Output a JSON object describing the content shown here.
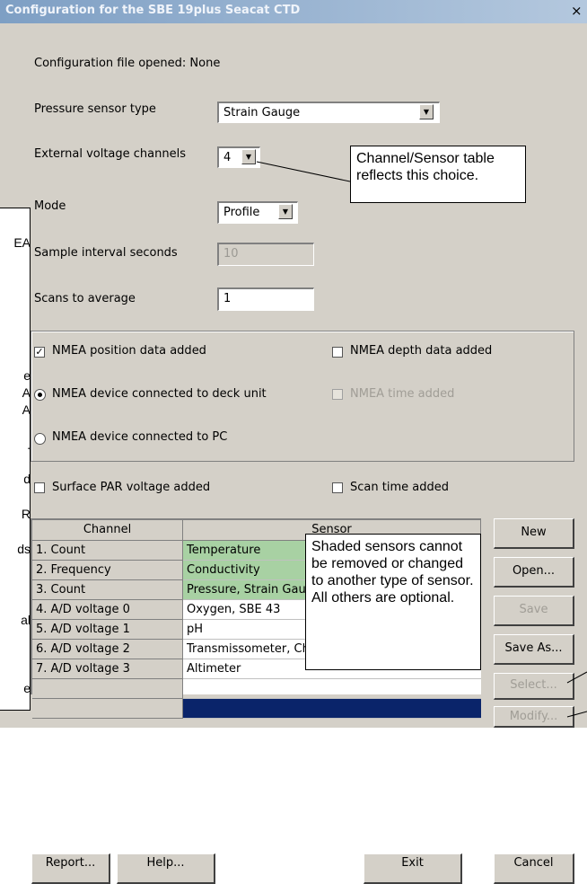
{
  "window": {
    "title": "Configuration for the SBE 19plus Seacat CTD",
    "close_glyph": "×"
  },
  "form": {
    "config_file_label": "Configuration file opened: None",
    "pressure_sensor_label": "Pressure sensor type",
    "pressure_sensor_value": "Strain Gauge",
    "ext_voltage_label": "External voltage channels",
    "ext_voltage_value": "4",
    "mode_label": "Mode",
    "mode_value": "Profile",
    "sample_interval_label": "Sample interval seconds",
    "sample_interval_value": "10",
    "scans_label": "Scans to average",
    "scans_value": "1"
  },
  "nmea": {
    "position_label": "NMEA position data added",
    "position_checked": true,
    "depth_label": "NMEA depth data added",
    "depth_checked": false,
    "deck_unit_label": "NMEA device connected to deck unit",
    "deck_unit_selected": true,
    "time_label": "NMEA time added",
    "time_checked": false,
    "pc_label": "NMEA device connected to PC",
    "pc_selected": false
  },
  "extras": {
    "par_label": "Surface PAR voltage added",
    "par_checked": false,
    "scan_time_label": "Scan time added",
    "scan_time_checked": false
  },
  "table": {
    "headers": [
      "Channel",
      "Sensor"
    ],
    "rows": [
      {
        "channel": "1. Count",
        "sensor": "Temperature",
        "shaded": true
      },
      {
        "channel": "2. Frequency",
        "sensor": "Conductivity",
        "shaded": true
      },
      {
        "channel": "3. Count",
        "sensor": "Pressure, Strain Gauge",
        "shaded": true
      },
      {
        "channel": "4. A/D voltage 0",
        "sensor": "Oxygen, SBE 43",
        "shaded": false
      },
      {
        "channel": "5. A/D voltage 1",
        "sensor": "pH",
        "shaded": false
      },
      {
        "channel": "6. A/D voltage 2",
        "sensor": "Transmissometer, Chelsea/Seatech/Wetlab",
        "shaded": false
      },
      {
        "channel": "7. A/D voltage 3",
        "sensor": "Altimeter",
        "shaded": false
      },
      {
        "channel": "",
        "sensor": "",
        "shaded": false
      },
      {
        "channel": "",
        "sensor": "",
        "shaded": false,
        "selected": true
      }
    ],
    "selected_color": "#0a246a",
    "shaded_color": "#a8d1a3"
  },
  "side_buttons": {
    "new": "New",
    "open": "Open...",
    "save": "Save",
    "save_as": "Save As...",
    "select": "Select...",
    "modify": "Modify..."
  },
  "bottom_buttons": {
    "report": "Report...",
    "help": "Help...",
    "exit": "Exit",
    "cancel": "Cancel"
  },
  "callouts": {
    "channel_table": "Channel/Sensor table reflects this choice.",
    "shaded": "Shaded sensors cannot be removed or changed to another type of sensor. All others are optional."
  },
  "left_fragments": [
    "EA",
    "e",
    "A",
    "A",
    ".",
    "d",
    "R",
    "ds",
    "al",
    "e"
  ]
}
